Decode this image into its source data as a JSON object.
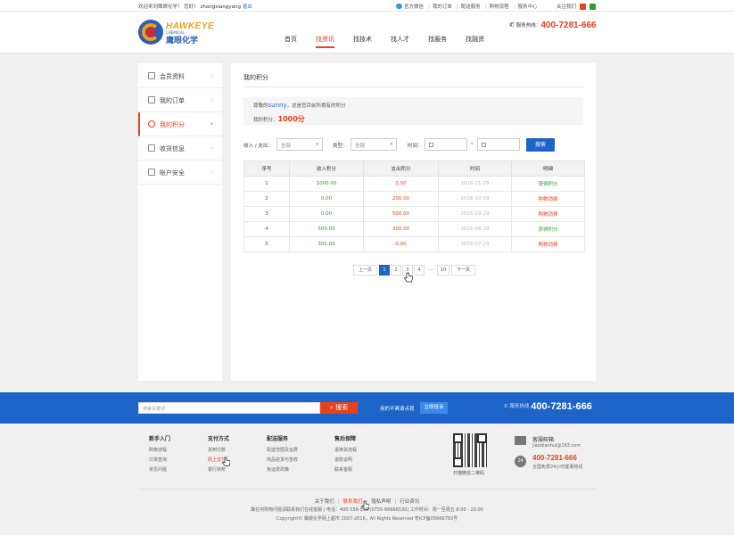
{
  "topbar": {
    "welcome": "欢迎来到鹰眼化学！",
    "greeting": "您好！",
    "username": "zhangxiangyang",
    "logout": "退出",
    "links": [
      "官方微信",
      "我的订单",
      "配送服务",
      "购物流程",
      "服务中心"
    ],
    "follow": "关注我们"
  },
  "logo": {
    "en": "HAWKEYE",
    "sub": "CHEMICAL",
    "cn": "鹰眼化学"
  },
  "header": {
    "hotline_label": "服务热线：",
    "hotline": "400-7281-666"
  },
  "nav": [
    {
      "label": "首页"
    },
    {
      "label": "找资讯",
      "active": true
    },
    {
      "label": "找技术"
    },
    {
      "label": "找人才"
    },
    {
      "label": "找服务"
    },
    {
      "label": "找融资"
    }
  ],
  "sidebar": {
    "items": [
      {
        "label": "会员资料",
        "icon": "member-icon"
      },
      {
        "label": "我的订单",
        "icon": "order-icon"
      },
      {
        "label": "我的积分",
        "icon": "points-icon",
        "active": true
      },
      {
        "label": "收货信息",
        "icon": "address-icon"
      },
      {
        "label": "账户安全",
        "icon": "security-icon"
      }
    ]
  },
  "main": {
    "title": "我的积分",
    "info_prefix": "尊敬的",
    "info_name": "sunny",
    "info_suffix": "，这是您目前所拥有的积分",
    "points_label": "我的积分：",
    "points_value": "1000分"
  },
  "filters": {
    "io_label": "收入 / 支出：",
    "io_value": "全部",
    "type_label": "类型：",
    "type_value": "全部",
    "time_label": "时间：",
    "range_sep": "~",
    "search": "搜索"
  },
  "table": {
    "headers": [
      "序号",
      "收入积分",
      "支出积分",
      "时间",
      "明细"
    ],
    "rows": [
      {
        "no": "1",
        "income": "1000.00",
        "expense": "0.00",
        "time": "2016-11-29",
        "detail": "获得积分",
        "kind": "earn"
      },
      {
        "no": "2",
        "income": "0.00",
        "expense": "200.00",
        "time": "2016-10-29",
        "detail": "购物消费",
        "kind": "spend"
      },
      {
        "no": "3",
        "income": "0.00",
        "expense": "500.00",
        "time": "2016-09-29",
        "detail": "购物消费",
        "kind": "spend"
      },
      {
        "no": "4",
        "income": "500.00",
        "expense": "300.00",
        "time": "2016-08-29",
        "detail": "获得积分",
        "kind": "earn"
      },
      {
        "no": "5",
        "income": "300.00",
        "expense": "0.00",
        "time": "2016-07-29",
        "detail": "购物消费",
        "kind": "spend"
      }
    ]
  },
  "pagination": {
    "prev": "上一页",
    "pages": [
      "1",
      "2",
      "3",
      "4"
    ],
    "current": "1",
    "ellipsis": "…",
    "last": "10",
    "next": "下一页"
  },
  "footer_bar": {
    "search_placeholder": "搜索关键词",
    "search_button": "搜索",
    "message": "用的不爽请点我",
    "complain": "立即投诉",
    "hotline_label": "服务热线",
    "hotline": "400-7281-666"
  },
  "footer_cols": [
    {
      "title": "新手入门",
      "items": [
        "购物流程",
        "订单查询",
        "常见问题"
      ]
    },
    {
      "title": "支付方式",
      "items": [
        "货到付款",
        "网上支付",
        "银行转账"
      ]
    },
    {
      "title": "配送服务",
      "items": [
        "配送范围及运费",
        "商品验货与签收",
        "免运费政策"
      ]
    },
    {
      "title": "售后保障",
      "items": [
        "退换货流程",
        "退款说明",
        "联系客服"
      ]
    }
  ],
  "footer_contact": {
    "qr_label": "扫描微信二维码",
    "mail_title": "客服邮箱",
    "mail": "jiaodianhui@163.com",
    "phone": "400-7281-666",
    "phone_note": "全国免费24小时客服热线"
  },
  "footer_links": [
    "关于我们",
    "联系我们",
    "隐私声明",
    "行业资讯"
  ],
  "footer_line1": "鹰任何购物问题请联系我们在线客服 | 电话：400-558-558 /0755-66666530| 工作时间：周一至周五 8:00 - 20:00",
  "footer_line2": "Copyright© 鹰眼化学网上超市 2007-2016，All Rights Reserved   粤ICP备05666793号"
}
